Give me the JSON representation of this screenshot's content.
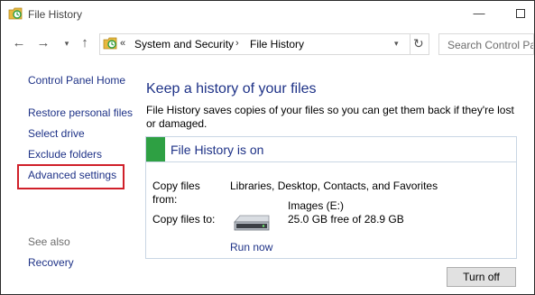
{
  "window": {
    "title": "File History",
    "minimize_glyph": "—",
    "icons": {
      "app": "file-history-icon"
    }
  },
  "nav": {
    "back_glyph": "←",
    "forward_glyph": "→",
    "recent_glyph": "▾",
    "up_glyph": "↑"
  },
  "address_bar": {
    "overflow_glyph": "«",
    "breadcrumbs": [
      "System and Security",
      "File History"
    ],
    "separator_glyph": "›",
    "dropdown_glyph": "▾",
    "refresh_glyph": "↻"
  },
  "search": {
    "placeholder": "Search Control Panel"
  },
  "sidebar": {
    "home": "Control Panel Home",
    "links": [
      "Restore personal files",
      "Select drive",
      "Exclude folders",
      "Advanced settings"
    ],
    "highlighted_link": "Advanced settings",
    "see_also_heading": "See also",
    "see_also_links": [
      "Recovery"
    ]
  },
  "main": {
    "title": "Keep a history of your files",
    "description": "File History saves copies of your files so you can get them back if they're lost or damaged.",
    "status": {
      "title": "File History is on",
      "color": "#2ea043",
      "copy_from_label": "Copy files from:",
      "copy_from_value": "Libraries, Desktop, Contacts, and Favorites",
      "copy_to_label": "Copy files to:",
      "drive_name": "Images (E:)",
      "drive_space": "25.0 GB free of 28.9 GB",
      "run_now": "Run now"
    },
    "turn_off_button": "Turn off"
  },
  "colors": {
    "link": "#1e3287",
    "highlight_border": "#d0202a",
    "panel_border": "#c9d6e4"
  }
}
